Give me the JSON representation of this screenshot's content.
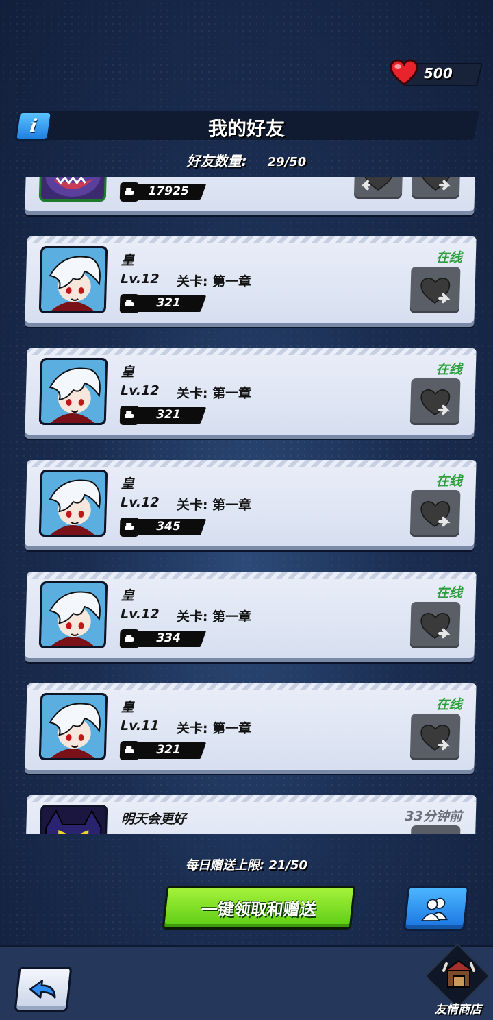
{
  "hearts": {
    "value": "500"
  },
  "header": {
    "info_icon": "i",
    "title": "我的好友",
    "friend_count_label": "好友数量:",
    "friend_count_value": "29/50"
  },
  "friends": [
    {
      "name": "",
      "level": "",
      "stage": "",
      "power": "17925",
      "status": "",
      "avatar": "monster-avatar"
    },
    {
      "name": "皇",
      "level": "Lv.12",
      "stage": "关卡: 第一章",
      "power": "321",
      "status": "在线",
      "avatar": "white-hair-avatar"
    },
    {
      "name": "皇",
      "level": "Lv.12",
      "stage": "关卡: 第一章",
      "power": "321",
      "status": "在线",
      "avatar": "white-hair-avatar"
    },
    {
      "name": "皇",
      "level": "Lv.12",
      "stage": "关卡: 第一章",
      "power": "345",
      "status": "在线",
      "avatar": "white-hair-avatar"
    },
    {
      "name": "皇",
      "level": "Lv.12",
      "stage": "关卡: 第一章",
      "power": "334",
      "status": "在线",
      "avatar": "white-hair-avatar"
    },
    {
      "name": "皇",
      "level": "Lv.11",
      "stage": "关卡: 第一章",
      "power": "321",
      "status": "在线",
      "avatar": "white-hair-avatar"
    },
    {
      "name": "明天会更好",
      "level": "",
      "stage": "",
      "power": "",
      "status": "33分钟前",
      "avatar": "dark-demon-avatar"
    }
  ],
  "bottom": {
    "daily_limit": "每日赠送上限: 21/50",
    "claim_button": "一键领取和赠送",
    "shop_label": "友情商店"
  },
  "colors": {
    "online": "#2b9d3b",
    "claim_green": "#7ee02a",
    "accent_blue": "#2d8cf0"
  }
}
